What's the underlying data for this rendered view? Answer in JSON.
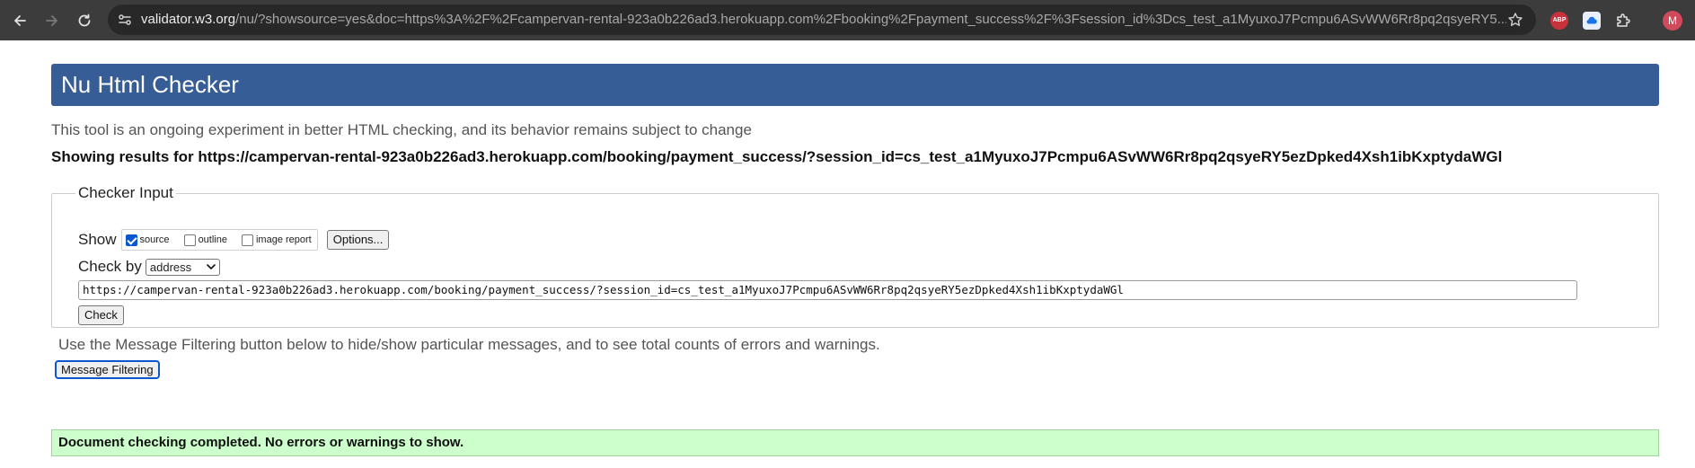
{
  "browser": {
    "url_host": "validator.w3.org",
    "url_rest": "/nu/?showsource=yes&doc=https%3A%2F%2Fcampervan-rental-923a0b226ad3.herokuapp.com%2Fbooking%2Fpayment_success%2F%3Fsession_id%3Dcs_test_a1MyuxoJ7Pcmpu6ASvWW6Rr8pq2qsyeRY5...",
    "avatar_letter": "M",
    "abp_label": "ABP"
  },
  "page": {
    "title": "Nu Html Checker",
    "tagline": "This tool is an ongoing experiment in better HTML checking, and its behavior remains subject to change",
    "showing_results": "Showing results for https://campervan-rental-923a0b226ad3.herokuapp.com/booking/payment_success/?session_id=cs_test_a1MyuxoJ7Pcmpu6ASvWW6Rr8pq2qsyeRY5ezDpked4Xsh1ibKxptydaWGl"
  },
  "checker": {
    "legend": "Checker Input",
    "show_label": "Show",
    "options": [
      {
        "label": "source",
        "checked": true
      },
      {
        "label": "outline",
        "checked": false
      },
      {
        "label": "image report",
        "checked": false
      }
    ],
    "options_button": "Options...",
    "check_by_label": "Check by",
    "check_by_value": "address",
    "url_value": "https://campervan-rental-923a0b226ad3.herokuapp.com/booking/payment_success/?session_id=cs_test_a1MyuxoJ7Pcmpu6ASvWW6Rr8pq2qsyeRY5ezDpked4Xsh1ibKxptydaWGl",
    "check_button": "Check"
  },
  "filtering": {
    "note": "Use the Message Filtering button below to hide/show particular messages, and to see total counts of errors and warnings.",
    "button": "Message Filtering"
  },
  "result": {
    "message": "Document checking completed. No errors or warnings to show."
  },
  "colors": {
    "banner": "#365d95",
    "success_bg": "#ccffcc",
    "toolbar": "#3c3c3c"
  }
}
